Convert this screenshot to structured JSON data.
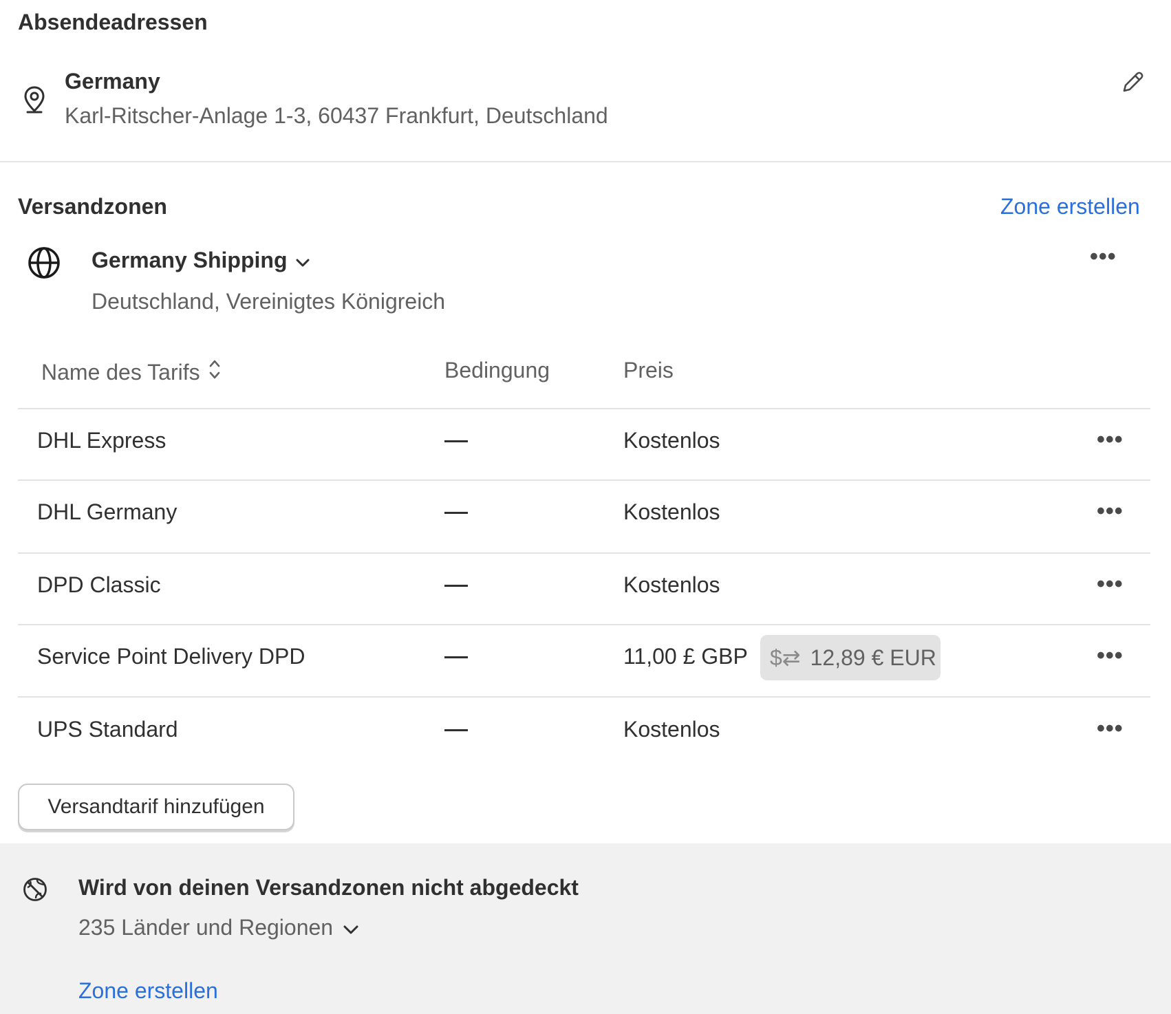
{
  "origins": {
    "title": "Absendeadressen",
    "address": {
      "name": "Germany",
      "line": "Karl-Ritscher-Anlage 1-3, 60437 Frankfurt, Deutschland"
    }
  },
  "zones": {
    "title": "Versandzonen",
    "create_label": "Zone erstellen",
    "zone": {
      "name": "Germany Shipping",
      "countries": "Deutschland, Vereinigtes Königreich"
    },
    "table": {
      "headers": {
        "name": "Name des Tarifs",
        "condition": "Bedingung",
        "price": "Preis"
      },
      "rows": [
        {
          "name": "DHL Express",
          "price": "Kostenlos"
        },
        {
          "name": "DHL Germany",
          "price": "Kostenlos"
        },
        {
          "name": "DPD Classic",
          "price": "Kostenlos"
        },
        {
          "name": "Service Point Delivery DPD",
          "price": "11,00 £ GBP",
          "converted": "12,89 € EUR"
        },
        {
          "name": "UPS Standard",
          "price": "Kostenlos"
        }
      ]
    },
    "add_rate_label": "Versandtarif hinzufügen"
  },
  "uncovered": {
    "title": "Wird von deinen Versandzonen nicht abgedeckt",
    "count_label": "235 Länder und Regionen",
    "create_label": "Zone erstellen"
  },
  "colors": {
    "link": "#2a6fdb",
    "text": "#303030",
    "subdued": "#616161",
    "footer_bg": "#f1f1f1"
  }
}
